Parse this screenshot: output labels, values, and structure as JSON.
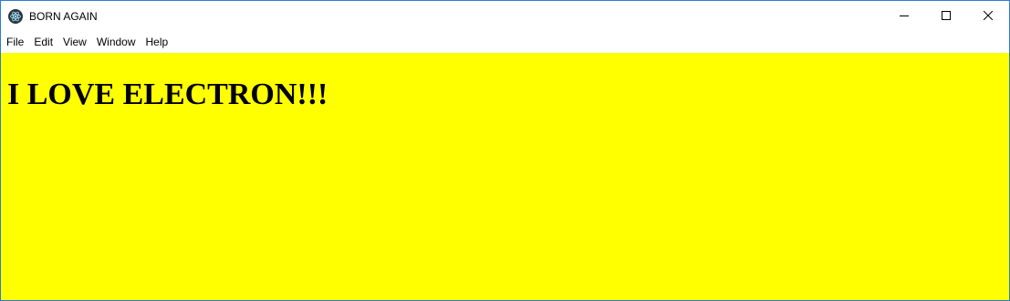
{
  "window": {
    "title": "BORN AGAIN",
    "icon": "electron-atom-icon",
    "controls": [
      "minimize-icon",
      "maximize-icon",
      "close-icon"
    ]
  },
  "menu": {
    "items": [
      {
        "label": "File"
      },
      {
        "label": "Edit"
      },
      {
        "label": "View"
      },
      {
        "label": "Window"
      },
      {
        "label": "Help"
      }
    ]
  },
  "content": {
    "heading": "I LOVE ELECTRON!!!",
    "background_color": "#ffff00"
  }
}
